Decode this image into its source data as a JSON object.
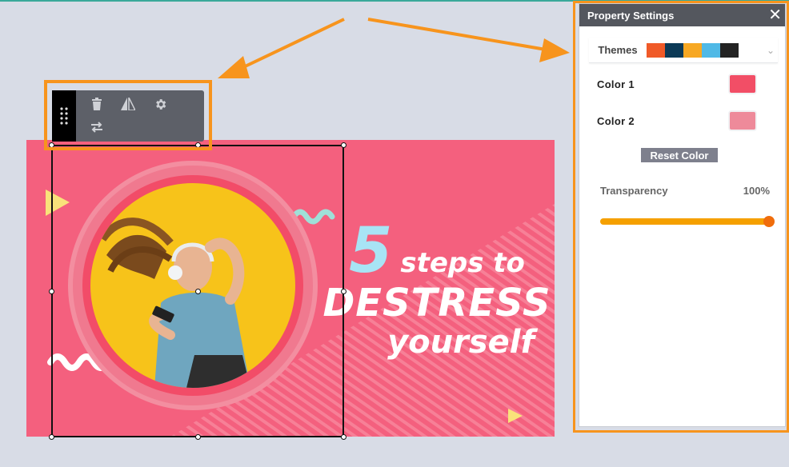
{
  "canvas": {
    "headline_number": "5",
    "headline_steps": "steps to",
    "headline_main": "DESTRESS",
    "headline_tail": "yourself"
  },
  "toolbar": {
    "icons": [
      "drag-handle-icon",
      "trash-icon",
      "flip-icon",
      "gear-icon",
      "swap-icon"
    ]
  },
  "panel": {
    "title": "Property Settings",
    "close_label": "✕",
    "themes_label": "Themes",
    "theme_colors": [
      "#f05a28",
      "#0c3a57",
      "#f7a823",
      "#4fb9e6",
      "#232323"
    ],
    "color1_label": "Color  1",
    "color1_value": "#f24e66",
    "color2_label": "Color  2",
    "color2_value": "#ee8a9a",
    "reset_label": "Reset Color",
    "transparency_label": "Transparency",
    "transparency_value": "100%",
    "transparency_level": 1.0
  },
  "colors": {
    "accent_orange": "#f7941d",
    "banner_pink": "#f4607e"
  }
}
